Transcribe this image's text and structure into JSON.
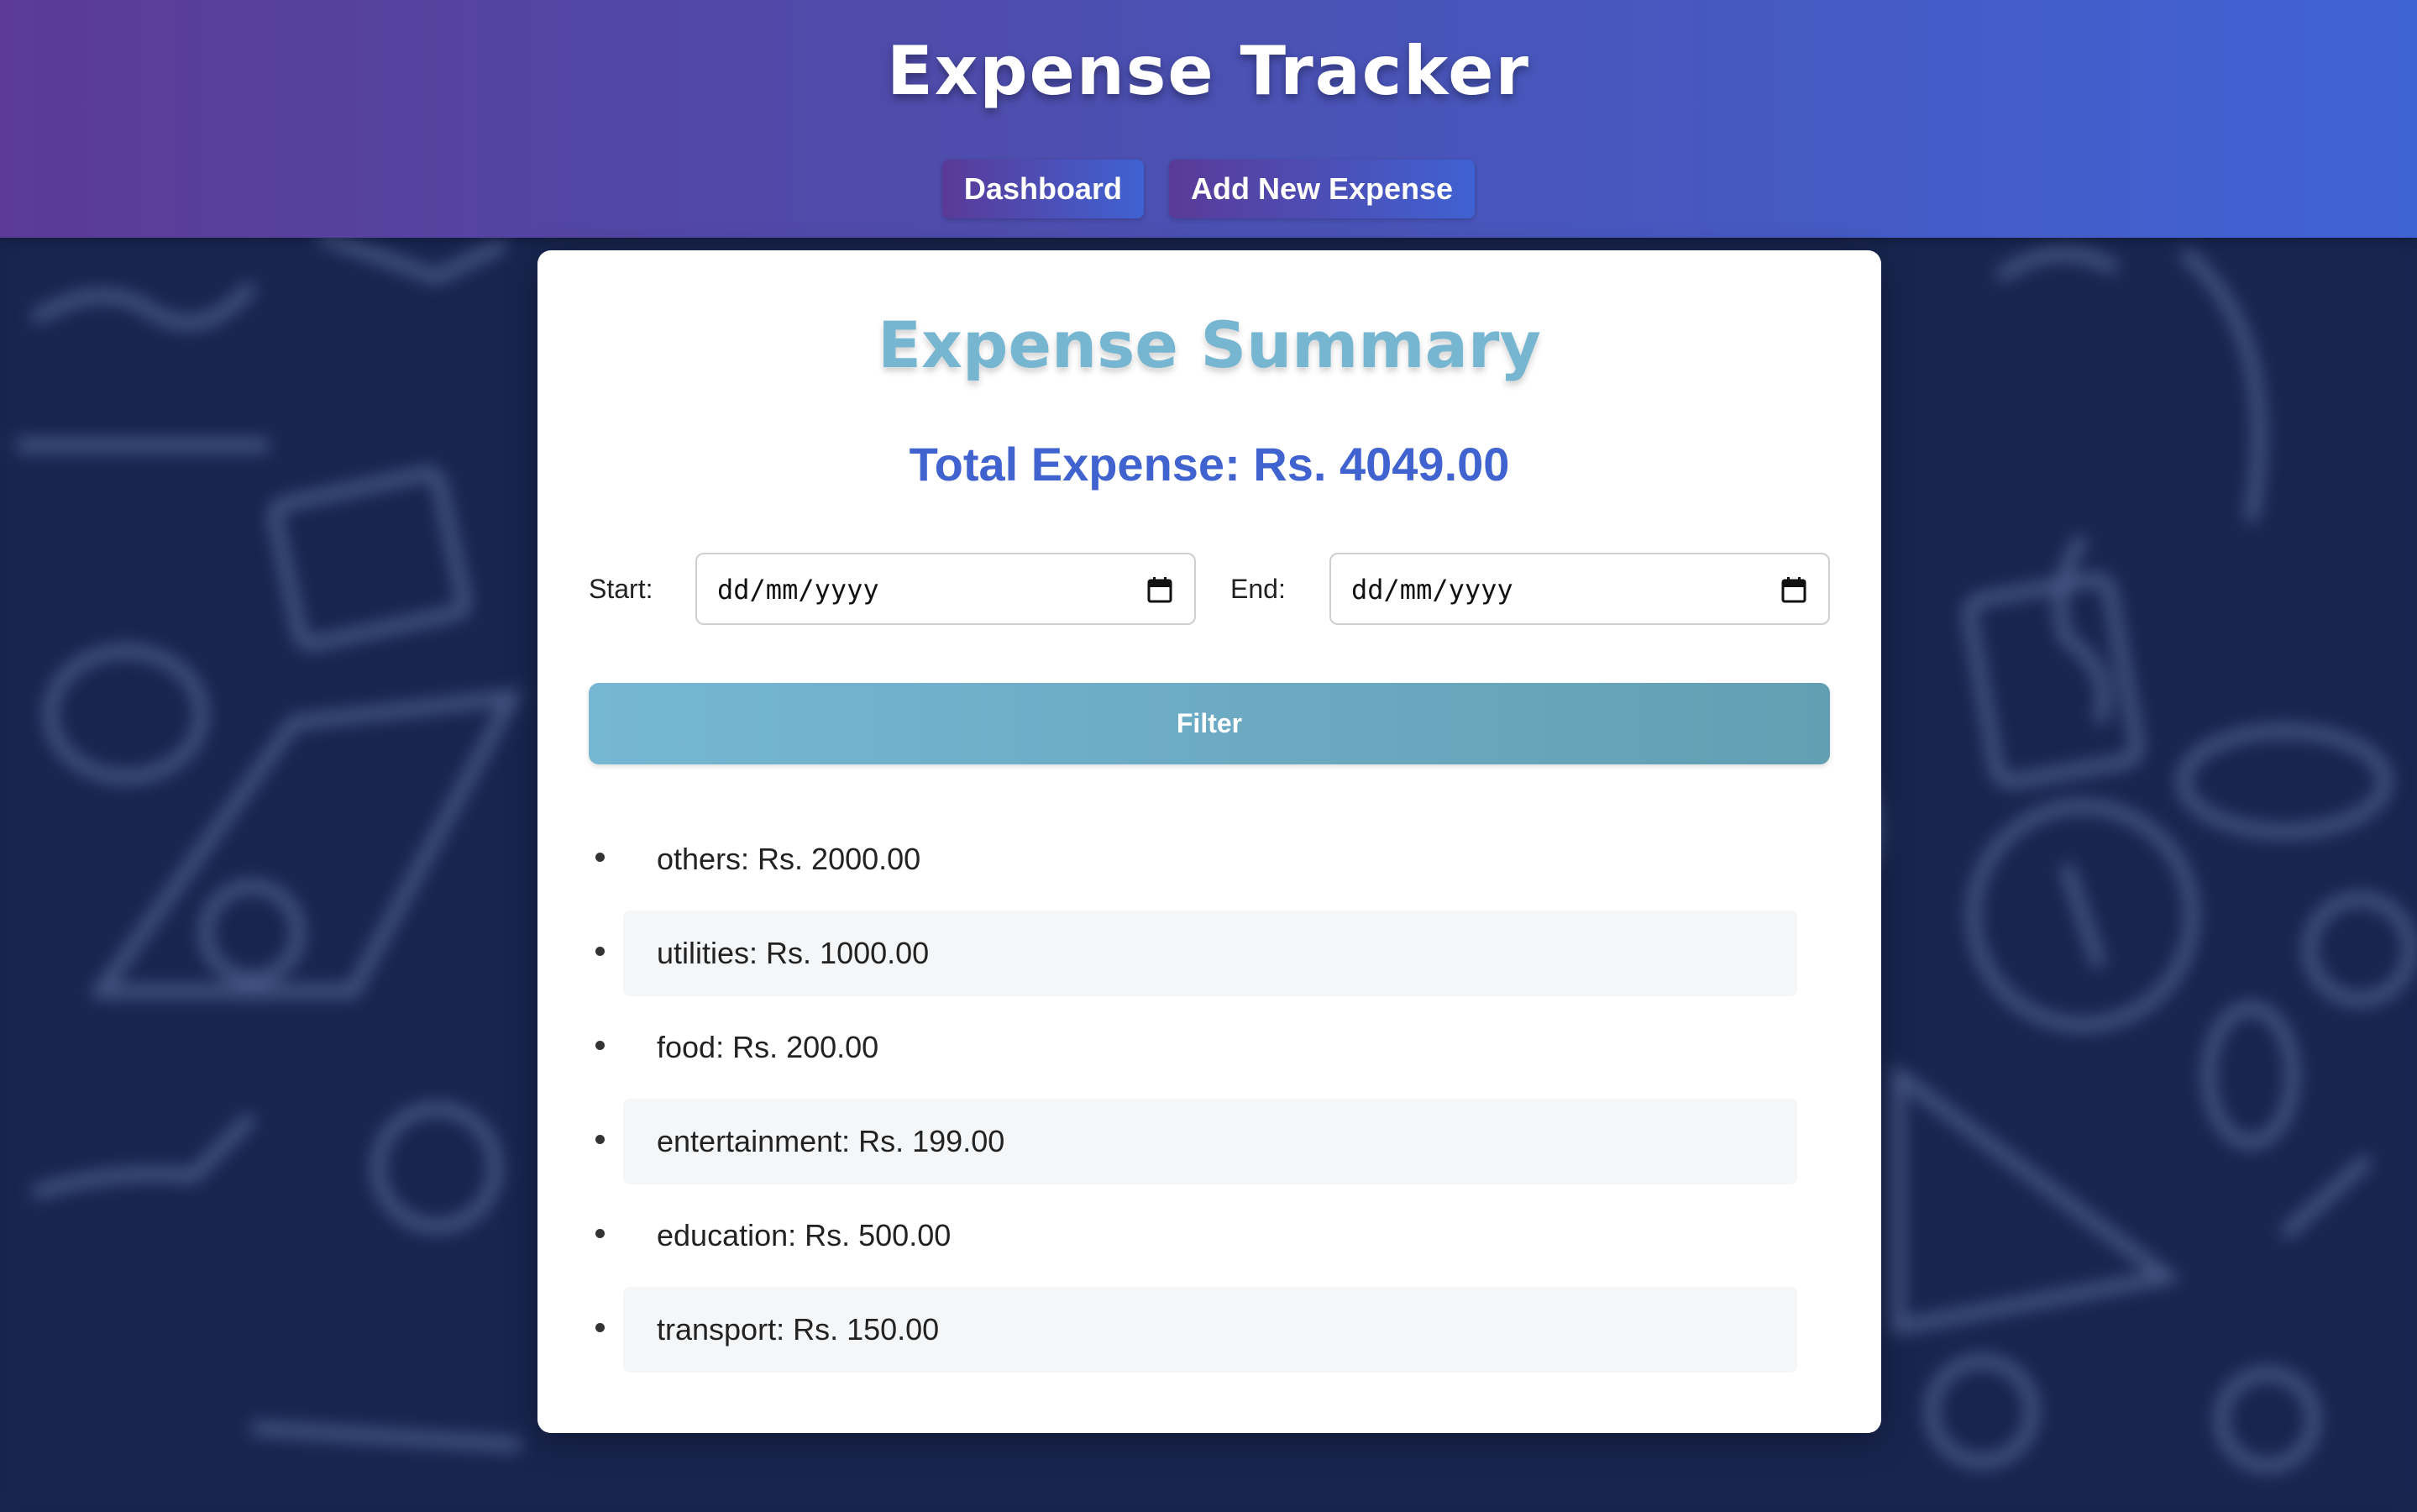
{
  "header": {
    "title": "Expense Tracker",
    "nav": [
      {
        "label": "Dashboard"
      },
      {
        "label": "Add New Expense"
      }
    ]
  },
  "summary": {
    "title": "Expense Summary",
    "total_text": "Total Expense: Rs. 4049.00",
    "filter": {
      "start_label": "Start:",
      "start_value": "dd/mm/yyyy",
      "end_label": "End:",
      "end_value": "dd/mm/yyyy",
      "button_label": "Filter"
    },
    "categories": [
      {
        "text": "others: Rs. 2000.00"
      },
      {
        "text": "utilities: Rs. 1000.00"
      },
      {
        "text": "food: Rs. 200.00"
      },
      {
        "text": "entertainment: Rs. 199.00"
      },
      {
        "text": "education: Rs. 500.00"
      },
      {
        "text": "transport: Rs. 150.00"
      }
    ]
  },
  "colors": {
    "header_gradient_start": "#5b3b96",
    "header_gradient_end": "#4063d4",
    "summary_title": "#76b6d0",
    "total_text": "#4063d0",
    "filter_button": "#6fb0c8",
    "background": "#18254f"
  },
  "icons": {
    "date_picker": "calendar-icon",
    "list_bullet": "bullet-icon"
  }
}
